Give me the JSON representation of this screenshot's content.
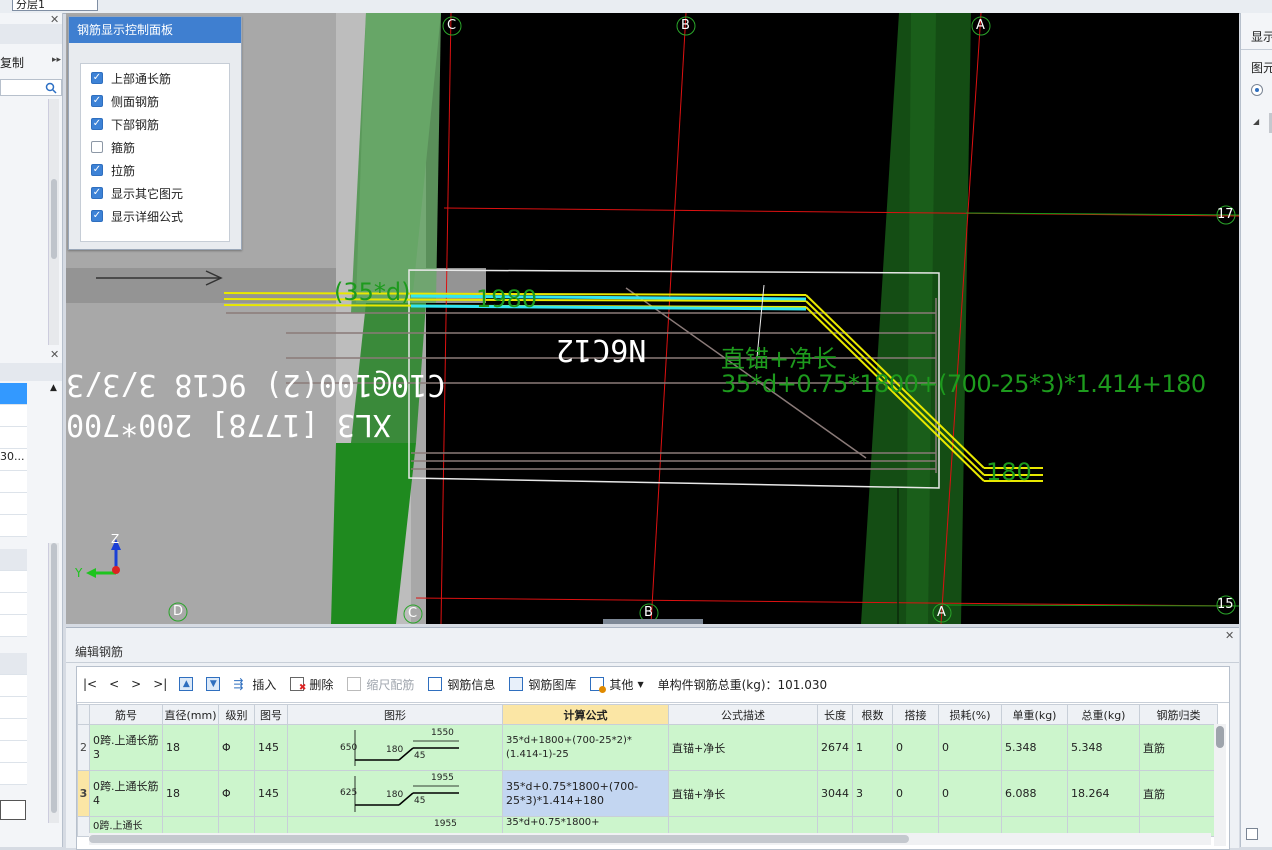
{
  "top": {
    "floor_select": "分层1"
  },
  "left_panel": {
    "text_copy": "复制",
    "search_icon": "search-icon",
    "cell_value": "30..."
  },
  "control_panel": {
    "title": "钢筋显示控制面板",
    "options": [
      {
        "label": "上部通长筋",
        "checked": true
      },
      {
        "label": "侧面钢筋",
        "checked": true
      },
      {
        "label": "下部钢筋",
        "checked": true
      },
      {
        "label": "箍筋",
        "checked": false
      },
      {
        "label": "拉筋",
        "checked": true
      },
      {
        "label": "显示其它图元",
        "checked": true
      },
      {
        "label": "显示详细公式",
        "checked": true
      }
    ]
  },
  "viewport": {
    "axis_labels_top": [
      "C",
      "B",
      "A"
    ],
    "axis_labels_bottom": [
      "D",
      "C",
      "B",
      "A"
    ],
    "row_labels": [
      "17",
      "15"
    ],
    "beam_label_1": "XL3 [1778] 200*700",
    "beam_label_2": "C10@100(2) 9C18 3/3/3",
    "beam_label_3": "N6C12",
    "dim_anchor": "(35*d)",
    "dim_length": "1980",
    "dim_tail": "180",
    "formula_label": "直锚+净长",
    "formula_overlay": "35*d+0.75*1800+(700-25*3)*1.414+180",
    "axis_z": "Z",
    "axis_y": "Y"
  },
  "right_panel": {
    "label1": "显示",
    "label2": "图元"
  },
  "edit_panel": {
    "title": "编辑钢筋",
    "toolbar": {
      "first": "|<",
      "prev": "<",
      "next": ">",
      "last": ">|",
      "insert": "插入",
      "delete": "删除",
      "scale": "缩尺配筋",
      "info": "钢筋信息",
      "library": "钢筋图库",
      "other": "其他",
      "total": "单构件钢筋总重(kg)：101.030"
    },
    "columns": [
      "筋号",
      "直径(mm)",
      "级别",
      "图号",
      "图形",
      "计算公式",
      "公式描述",
      "长度",
      "根数",
      "搭接",
      "损耗(%)",
      "单重(kg)",
      "总重(kg)",
      "钢筋归类"
    ],
    "rows": [
      {
        "no": "2",
        "name": "0跨.上通长筋3",
        "dia": "18",
        "grade": "Φ",
        "fig": "145",
        "shape": {
          "top": "1550",
          "left": "650",
          "mid": "180",
          "angle": "45"
        },
        "formula": "35*d+1800+(700-25*2)*(1.414-1)-25",
        "desc": "直锚+净长",
        "length": "2674",
        "count": "1",
        "lap": "0",
        "loss": "0",
        "unit": "5.348",
        "total": "5.348",
        "cat": "直筋"
      },
      {
        "no": "3",
        "name": "0跨.上通长筋4",
        "dia": "18",
        "grade": "Φ",
        "fig": "145",
        "shape": {
          "top": "1955",
          "left": "625",
          "mid": "180",
          "angle": "45"
        },
        "formula": "35*d+0.75*1800+(700-25*3)*1.414+180",
        "desc": "直锚+净长",
        "length": "3044",
        "count": "3",
        "lap": "0",
        "loss": "0",
        "unit": "6.088",
        "total": "18.264",
        "cat": "直筋"
      },
      {
        "no": "",
        "name": "0跨.上通长",
        "dia": "",
        "grade": "",
        "fig": "",
        "shape": {
          "top": "1955",
          "left": "",
          "mid": "",
          "angle": ""
        },
        "formula": "35*d+0.75*1800+",
        "desc": "",
        "length": "",
        "count": "",
        "lap": "",
        "loss": "",
        "unit": "",
        "total": "",
        "cat": ""
      }
    ]
  }
}
